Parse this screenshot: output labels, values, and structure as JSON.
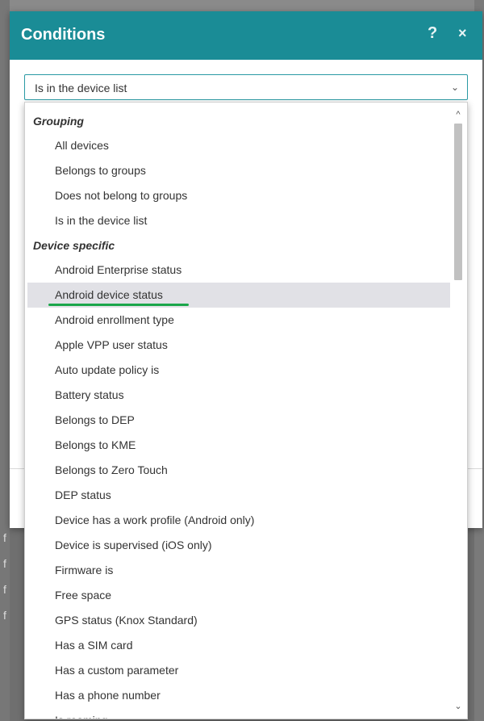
{
  "dialog": {
    "title": "Conditions",
    "help_glyph": "?",
    "close_glyph": "×",
    "header_color": "#1a8c96"
  },
  "select": {
    "value": "Is in the device list",
    "chevron_glyph": "⌄"
  },
  "dropdown": {
    "groups": [
      {
        "label": "Grouping",
        "options": [
          "All devices",
          "Belongs to groups",
          "Does not belong to groups",
          "Is in the device list"
        ]
      },
      {
        "label": "Device specific",
        "options": [
          "Android Enterprise status",
          "Android device status",
          "Android enrollment type",
          "Apple VPP user status",
          "Auto update policy is",
          "Battery status",
          "Belongs to DEP",
          "Belongs to KME",
          "Belongs to Zero Touch",
          "DEP status",
          "Device has a work profile (Android only)",
          "Device is supervised (iOS only)",
          "Firmware is",
          "Free space",
          "GPS status (Knox Standard)",
          "Has a SIM card",
          "Has a custom parameter",
          "Has a phone number",
          "Is roaming"
        ]
      }
    ],
    "highlighted_option": "Android device status",
    "highlight_underline_color": "#1aa64a",
    "scroll_up_glyph": "^",
    "scroll_down_glyph": "⌄"
  },
  "background": {
    "left_marks": [
      "f",
      "f",
      "f",
      "f"
    ]
  }
}
